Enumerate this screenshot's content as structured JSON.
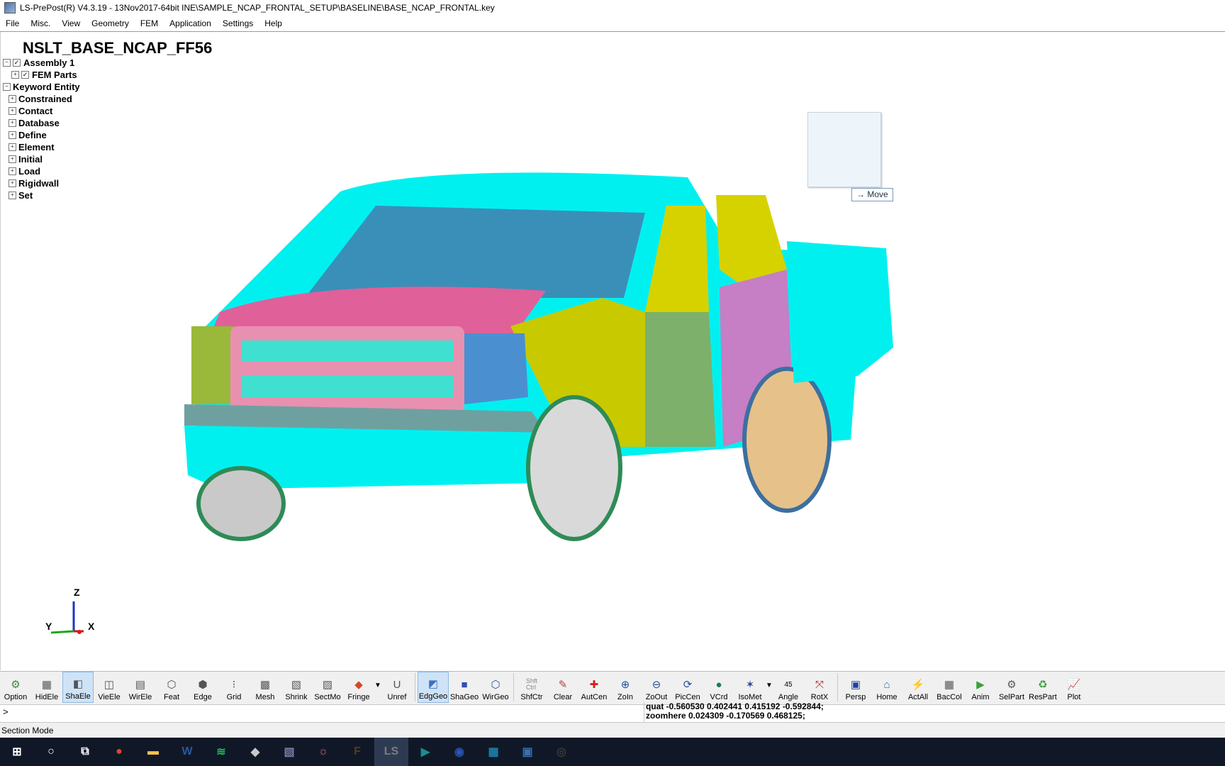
{
  "window": {
    "title": "LS-PrePost(R) V4.3.19 - 13Nov2017-64bit INE\\SAMPLE_NCAP_FRONTAL_SETUP\\BASELINE\\BASE_NCAP_FRONTAL.key"
  },
  "menu": [
    "File",
    "Misc.",
    "View",
    "Geometry",
    "FEM",
    "Application",
    "Settings",
    "Help"
  ],
  "viewport": {
    "model_title": "NSLT_BASE_NCAP_FF56",
    "tree": {
      "assembly": "Assembly 1",
      "fem_parts": "FEM Parts",
      "keyword_entity": "Keyword Entity",
      "items": [
        "Constrained",
        "Contact",
        "Database",
        "Define",
        "Element",
        "Initial",
        "Load",
        "Rigidwall",
        "Set"
      ]
    },
    "move_label": "Move",
    "axes": {
      "z": "Z",
      "y": "Y",
      "x": "X"
    }
  },
  "toolbar": {
    "buttons": [
      {
        "label": "Option",
        "icon": "option-icon"
      },
      {
        "label": "HidEle",
        "icon": "hidden-element-icon"
      },
      {
        "label": "ShaEle",
        "icon": "shaded-element-icon",
        "active": true
      },
      {
        "label": "VieEle",
        "icon": "view-element-icon"
      },
      {
        "label": "WirEle",
        "icon": "wire-element-icon"
      },
      {
        "label": "Feat",
        "icon": "feature-icon"
      },
      {
        "label": "Edge",
        "icon": "edge-icon"
      },
      {
        "label": "Grid",
        "icon": "grid-icon"
      },
      {
        "label": "Mesh",
        "icon": "mesh-icon"
      },
      {
        "label": "Shrink",
        "icon": "shrink-icon"
      },
      {
        "label": "SectMo",
        "icon": "section-mode-icon"
      },
      {
        "label": "Fringe",
        "icon": "fringe-icon"
      },
      {
        "label": "Unref",
        "icon": "unreferenced-icon"
      },
      {
        "label": "EdgGeo",
        "icon": "edge-geometry-icon",
        "active": true
      },
      {
        "label": "ShaGeo",
        "icon": "shaded-geometry-icon"
      },
      {
        "label": "WirGeo",
        "icon": "wire-geometry-icon"
      },
      {
        "label": "ShfCtr",
        "icon": "shift-ctrl-icon"
      },
      {
        "label": "Clear",
        "icon": "clear-icon"
      },
      {
        "label": "AutCen",
        "icon": "auto-center-icon"
      },
      {
        "label": "ZoIn",
        "icon": "zoom-in-icon"
      },
      {
        "label": "ZoOut",
        "icon": "zoom-out-icon"
      },
      {
        "label": "PicCen",
        "icon": "pick-center-icon"
      },
      {
        "label": "VCrd",
        "icon": "view-coordinate-icon"
      },
      {
        "label": "IsoMet",
        "icon": "isometric-icon"
      },
      {
        "label": "Angle",
        "icon": "angle-icon",
        "value": "45"
      },
      {
        "label": "RotX",
        "icon": "rotate-x-icon"
      },
      {
        "label": "Persp",
        "icon": "perspective-icon"
      },
      {
        "label": "Home",
        "icon": "home-icon"
      },
      {
        "label": "ActAll",
        "icon": "activate-all-icon"
      },
      {
        "label": "BacCol",
        "icon": "background-color-icon"
      },
      {
        "label": "Anim",
        "icon": "animate-icon"
      },
      {
        "label": "SelPart",
        "icon": "select-part-icon"
      },
      {
        "label": "ResPart",
        "icon": "restore-part-icon"
      },
      {
        "label": "Plot",
        "icon": "plot-icon"
      }
    ],
    "shfctr_text": "Shft\nCtrl"
  },
  "command": {
    "prompt": ">",
    "history": [
      "quat -0.560530 0.402441 0.415192 -0.592844;",
      "zoomhere 0.024309 -0.170569 0.468125;"
    ]
  },
  "status": {
    "mode": "Section Mode"
  },
  "taskbar": [
    {
      "name": "start-icon",
      "color": "#ffffff",
      "text": "⊞"
    },
    {
      "name": "search-icon",
      "color": "#ffffff",
      "text": "○"
    },
    {
      "name": "task-view-icon",
      "color": "#ffffff",
      "text": "⧉"
    },
    {
      "name": "chrome-icon",
      "color": "#e0442c",
      "text": "●"
    },
    {
      "name": "file-explorer-icon",
      "color": "#f2c14e",
      "text": "▬"
    },
    {
      "name": "word-icon",
      "color": "#2b579a",
      "text": "W"
    },
    {
      "name": "spotify-icon",
      "color": "#1db954",
      "text": "≋"
    },
    {
      "name": "app-icon-1",
      "color": "#c8c8c8",
      "text": "◆"
    },
    {
      "name": "app-icon-2",
      "color": "#7a7aa0",
      "text": "▧"
    },
    {
      "name": "app-icon-3",
      "color": "#d86a6a",
      "text": "☼"
    },
    {
      "name": "app-icon-4",
      "color": "#5a3a1a",
      "text": "F"
    },
    {
      "name": "lspp-icon",
      "color": "#7c7c7c",
      "text": "LS",
      "active": true
    },
    {
      "name": "app-icon-5",
      "color": "#1a8f8f",
      "text": "▶"
    },
    {
      "name": "app-icon-6",
      "color": "#2a55b3",
      "text": "◉"
    },
    {
      "name": "app-icon-7",
      "color": "#1d7fa8",
      "text": "▦"
    },
    {
      "name": "app-icon-8",
      "color": "#3a6fb0",
      "text": "▣"
    },
    {
      "name": "obs-icon",
      "color": "#3a3a3a",
      "text": "◎"
    }
  ]
}
